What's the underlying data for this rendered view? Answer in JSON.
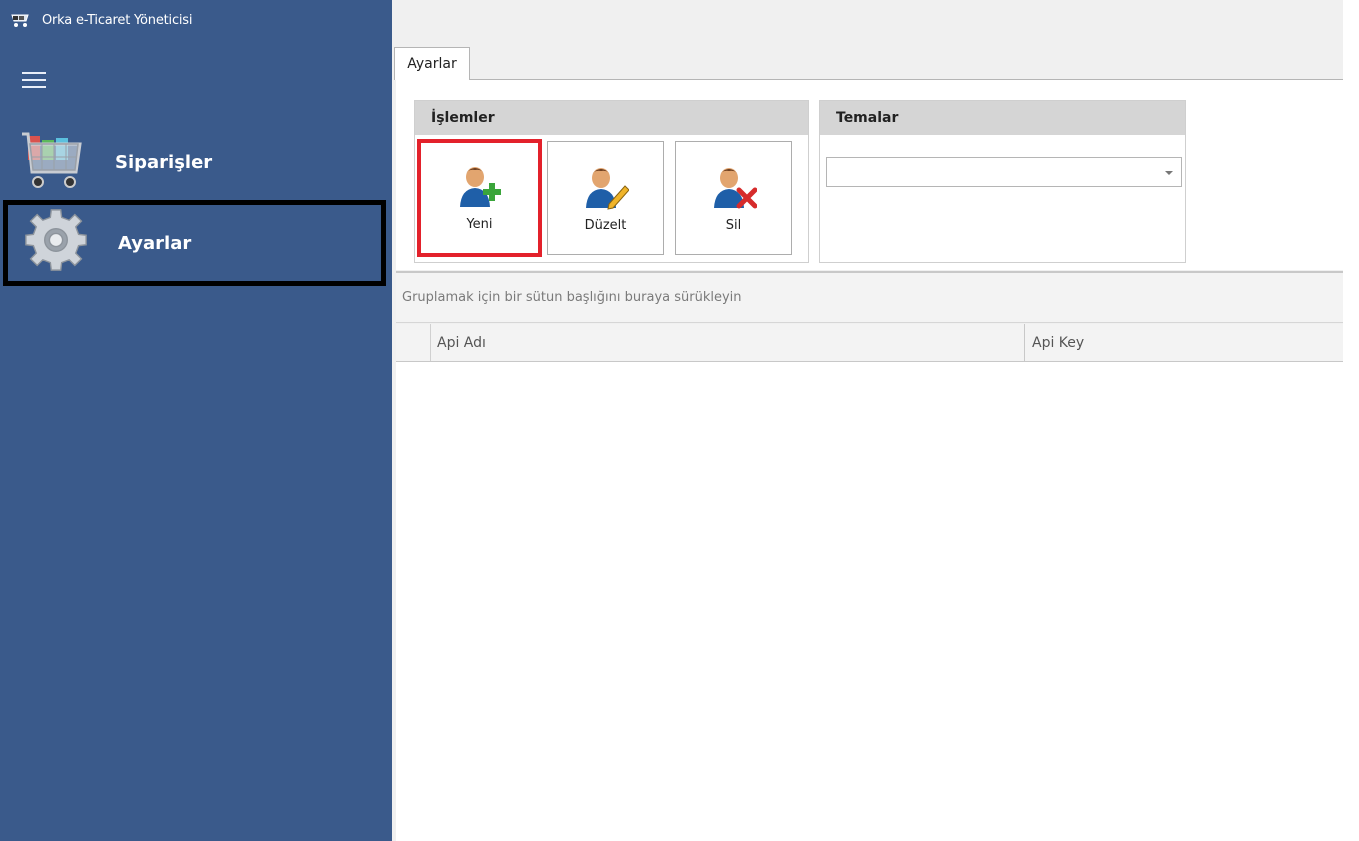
{
  "app": {
    "title": "Orka e-Ticaret Yöneticisi"
  },
  "sidebar": {
    "items": [
      {
        "label": "Siparişler",
        "icon": "shopping-cart-icon"
      },
      {
        "label": "Ayarlar",
        "icon": "gear-icon"
      }
    ]
  },
  "tabs": [
    {
      "label": "Ayarlar"
    }
  ],
  "ribbon": {
    "islemler": {
      "title": "İşlemler",
      "buttons": [
        {
          "label": "Yeni",
          "icon": "user-add-icon"
        },
        {
          "label": "Düzelt",
          "icon": "user-edit-icon"
        },
        {
          "label": "Sil",
          "icon": "user-delete-icon"
        }
      ]
    },
    "temalar": {
      "title": "Temalar",
      "value": ""
    }
  },
  "grid": {
    "group_panel_text": "Gruplamak için bir sütun başlığını buraya sürükleyin",
    "columns": [
      "Api Adı",
      "Api Key"
    ]
  },
  "colors": {
    "sidebar": "#3a5a8b",
    "highlight": "#e3212b"
  }
}
